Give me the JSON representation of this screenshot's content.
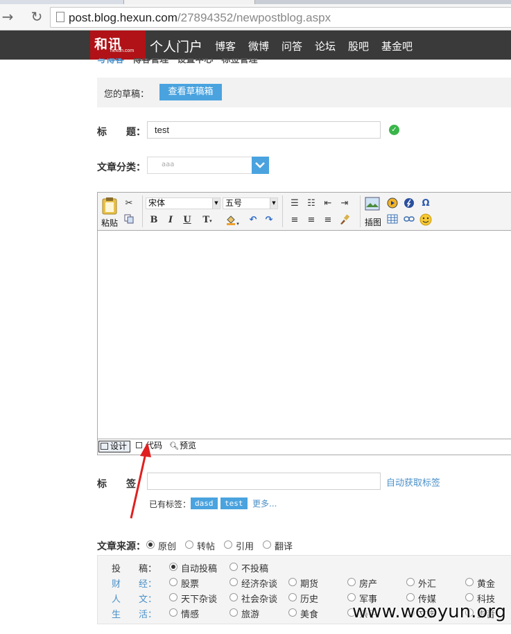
{
  "browser": {
    "url_host": "post.blog.hexun.com",
    "url_path": "/27894352/newpostblog.aspx",
    "back_icon": "arrow-right-icon",
    "reload_icon": "reload-icon"
  },
  "header": {
    "logo_text": "和讯",
    "logo_sub": "hexun.com",
    "portal": "个人门户",
    "nav": [
      "博客",
      "微博",
      "问答",
      "论坛",
      "股吧",
      "基金吧"
    ]
  },
  "subnav": [
    "写博客",
    "博客管理",
    "设置中心",
    "标签管理"
  ],
  "draft": {
    "label": "您的草稿：",
    "button": "查看草稿箱"
  },
  "title_field": {
    "label": "标　　题：",
    "value": "test"
  },
  "category_field": {
    "label": "文章分类：",
    "value": "aaa"
  },
  "toolbar": {
    "paste": "粘贴",
    "font_name": "宋体",
    "font_size": "五号",
    "image": "插图"
  },
  "modes": [
    "设计",
    "代码",
    "预览"
  ],
  "tags_field": {
    "label": "标　　签",
    "auto_link": "自动获取标签",
    "existing_label": "已有标签：",
    "tags": [
      "dasd",
      "test"
    ],
    "more": "更多..."
  },
  "source": {
    "label": "文章来源：",
    "options": [
      "原创",
      "转帖",
      "引用",
      "翻译"
    ],
    "selected": 0
  },
  "submit": {
    "label": "投　　稿：",
    "options": [
      "自动投稿",
      "不投稿"
    ],
    "selected": 0
  },
  "categories": [
    {
      "label": "财　　经：",
      "options": [
        "股票",
        "经济杂谈",
        "期货",
        "房产",
        "外汇",
        "黄金"
      ]
    },
    {
      "label": "人　　文：",
      "options": [
        "天下杂谈",
        "社会杂谈",
        "历史",
        "军事",
        "传媒",
        "科技"
      ]
    },
    {
      "label": "生　　活：",
      "options": [
        "情感",
        "旅游",
        "美食",
        "亲子",
        "文学",
        "影音"
      ]
    }
  ],
  "watermark": "www.wooyun.org",
  "colors": {
    "header_bg": "#3a3a3a",
    "logo_red": "#b01217",
    "accent_blue": "#4aa3df"
  }
}
